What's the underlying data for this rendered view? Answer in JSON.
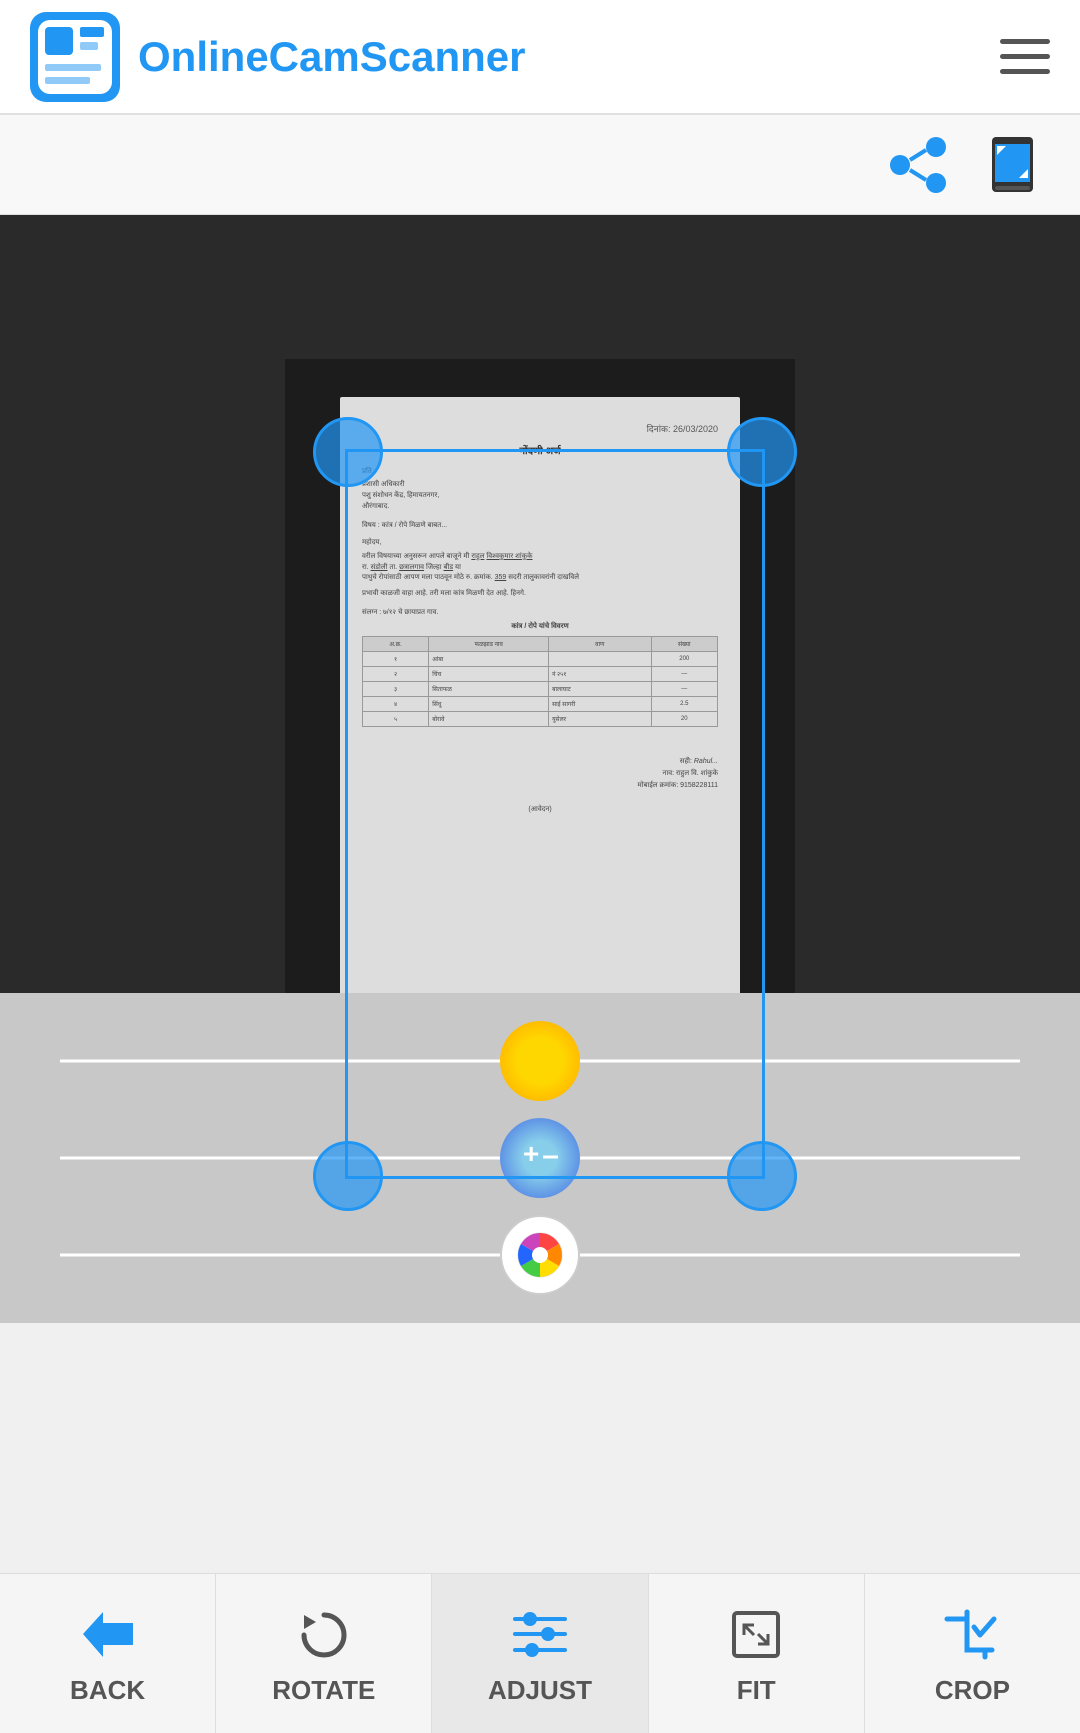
{
  "header": {
    "logo_text": "OnlineCamScanner",
    "logo_icon_alt": "app-logo"
  },
  "toolbar": {
    "share_label": "share",
    "fullscreen_label": "fullscreen"
  },
  "document": {
    "date_text": "दिनांक: 26/03/2020",
    "title_text": "नोंदणी अर्ज"
  },
  "sliders": {
    "brightness_label": "Brightness",
    "exposure_label": "Exposure",
    "color_label": "Color"
  },
  "bottom_nav": {
    "items": [
      {
        "id": "back",
        "label": "BACK"
      },
      {
        "id": "rotate",
        "label": "ROTATE"
      },
      {
        "id": "adjust",
        "label": "ADJUST"
      },
      {
        "id": "fit",
        "label": "FIT"
      },
      {
        "id": "crop",
        "label": "CROP"
      }
    ]
  }
}
